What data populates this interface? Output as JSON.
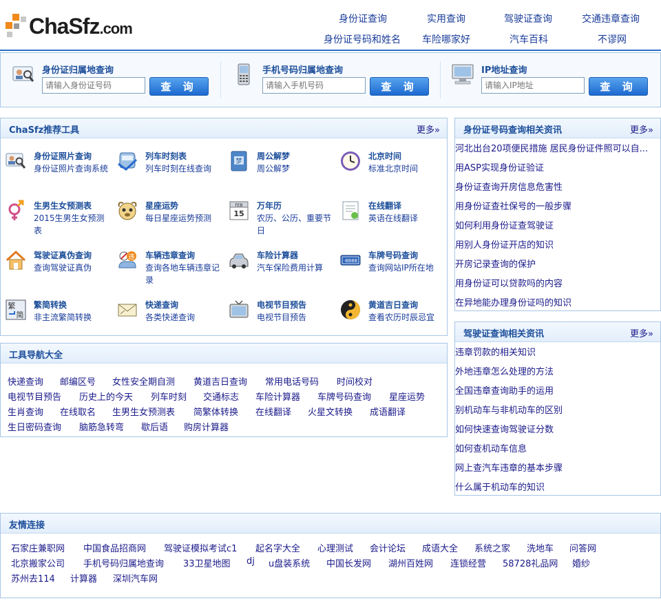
{
  "logo": {
    "text": "ChaSfz",
    "suffix": ".com"
  },
  "topnav": [
    "身份证查询",
    "实用查询",
    "驾驶证查询",
    "交通违章查询",
    "身份证号码和姓名",
    "车险哪家好",
    "汽车百科",
    "不谬网"
  ],
  "search": [
    {
      "title": "身份证归属地查询",
      "placeholder": "请输入身份证号码",
      "button": "查 询",
      "icon": "id-card-icon"
    },
    {
      "title": "手机号码归属地查询",
      "placeholder": "请输入手机号码",
      "button": "查 询",
      "icon": "mobile-phone-icon"
    },
    {
      "title": "IP地址查询",
      "placeholder": "请输入IP地址",
      "button": "查 询",
      "icon": "computer-icon"
    }
  ],
  "tools_box": {
    "title": "ChaSfz推荐工具",
    "more": "更多»",
    "items": [
      {
        "name": "身份证照片查询",
        "desc": "身份证照片查询系统",
        "icon": "id-photo-icon"
      },
      {
        "name": "列车时刻表",
        "desc": "列车时刻在线查询",
        "icon": "train-icon"
      },
      {
        "name": "周公解梦",
        "desc": "周公解梦",
        "icon": "dream-book-icon"
      },
      {
        "name": "北京时间",
        "desc": "标准北京时间",
        "icon": "clock-icon"
      },
      {
        "name": "生男生女预测表",
        "desc": "2015生男生女预测表",
        "icon": "gender-icon"
      },
      {
        "name": "星座运势",
        "desc": "每日星座运势预测",
        "icon": "zodiac-icon"
      },
      {
        "name": "万年历",
        "desc": "农历、公历、重要节日",
        "icon": "calendar-icon"
      },
      {
        "name": "在线翻译",
        "desc": "英语在线翻译",
        "icon": "translate-icon"
      },
      {
        "name": "驾驶证真伪查询",
        "desc": "查询驾驶证真伪",
        "icon": "house-icon"
      },
      {
        "name": "车辆违章查询",
        "desc": "查询各地车辆违章记录",
        "icon": "violation-icon"
      },
      {
        "name": "车险计算器",
        "desc": "汽车保险费用计算",
        "icon": "car-icon"
      },
      {
        "name": "车牌号码查询",
        "desc": "查询网站IP所在地",
        "icon": "license-plate-icon"
      },
      {
        "name": "繁简转换",
        "desc": "非主流繁简转换",
        "icon": "traditional-simplified-icon"
      },
      {
        "name": "快递查询",
        "desc": "各类快递查询",
        "icon": "envelope-icon"
      },
      {
        "name": "电视节目预告",
        "desc": "电视节目预告",
        "icon": "tv-icon"
      },
      {
        "name": "黄道吉日查询",
        "desc": "查看农历时辰忌宜",
        "icon": "yin-yang-icon"
      }
    ]
  },
  "nav_box": {
    "title": "工具导航大全",
    "rows": [
      [
        "快递查询",
        "邮编区号",
        "女性安全期自测",
        "黄道吉日查询",
        "常用电话号码",
        "时间校对"
      ],
      [
        "电视节目预告",
        "历史上的今天",
        "列车时刻",
        "交通标志",
        "车险计算器",
        "车牌号码查询",
        "星座运势"
      ],
      [
        "生肖查询",
        "在线取名",
        "生男生女预测表",
        "简繁体转换",
        "在线翻译",
        "火星文转换",
        "成语翻译"
      ],
      [
        "生日密码查询",
        "脑筋急转弯",
        "歇后语",
        "购房计算器"
      ]
    ]
  },
  "id_news": {
    "title": "身份证号码查询相关资讯",
    "more": "更多»",
    "items": [
      "河北出台20项便民措施 居民身份证件照可以自...",
      "用ASP实现身份证验证",
      "身份证查询开房信息危害性",
      "用身份证查社保号的一般步骤",
      "如何利用身份证查驾驶证",
      "用别人身份证开店的知识",
      "开房记录查询的保护",
      "用身份证可以贷款吗的内容",
      "在异地能办理身份证吗的知识"
    ]
  },
  "dl_news": {
    "title": "驾驶证查询相关资讯",
    "more": "更多»",
    "items": [
      "违章罚款的相关知识",
      "外地违章怎么处理的方法",
      "全国违章查询助手的运用",
      "别机动车与非机动车的区别",
      "如何快速查询驾驶证分数",
      "如何查机动车信息",
      "网上查汽车违章的基本步骤",
      "什么属于机动车的知识"
    ]
  },
  "friends": {
    "title": "友情连接",
    "rows": [
      [
        "石家庄兼职网",
        "中国食品招商网",
        "驾驶证模拟考试c1",
        "起名字大全",
        "心理测试",
        "会计论坛",
        "成语大全",
        "系统之家",
        "洗地车",
        "问答网"
      ],
      [
        "北京搬家公司",
        "手机号码归属地查询",
        "33卫星地图",
        "dj",
        "u盘装系统",
        "中国长发网",
        "湖州百姓网",
        "连锁经营",
        "58728礼品网",
        "婚纱"
      ],
      [
        "苏州去114",
        "计算器",
        "深圳汽车网"
      ]
    ]
  }
}
